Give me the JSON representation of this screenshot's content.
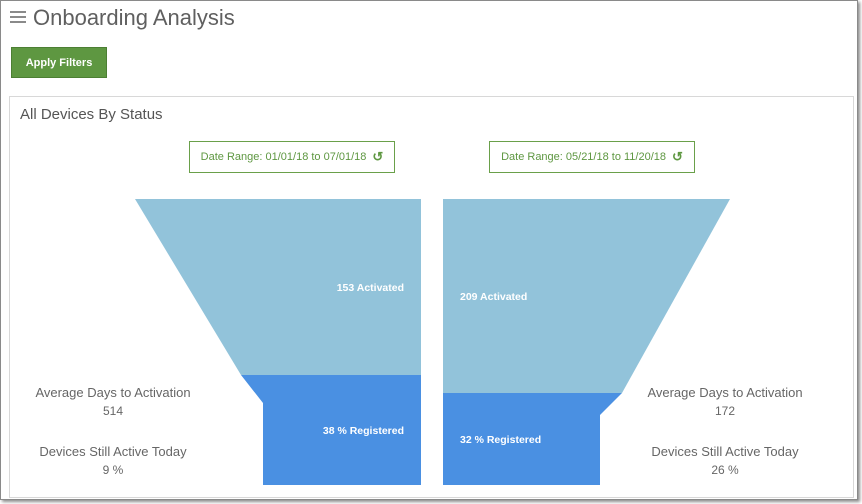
{
  "header": {
    "title": "Onboarding Analysis"
  },
  "toolbar": {
    "apply_filters_label": "Apply Filters"
  },
  "panel": {
    "title": "All Devices By Status",
    "left": {
      "date_range": "Date Range: 01/01/18 to 07/01/18",
      "activated": "153 Activated",
      "registered": "38 % Registered",
      "avg_days_label": "Average Days to Activation",
      "avg_days_value": "514",
      "still_active_label": "Devices Still Active Today",
      "still_active_value": "9 %"
    },
    "right": {
      "date_range": "Date Range: 05/21/18 to 11/20/18",
      "activated": "209 Activated",
      "registered": "32 % Registered",
      "avg_days_label": "Average Days to Activation",
      "avg_days_value": "172",
      "still_active_label": "Devices Still Active Today",
      "still_active_value": "26 %"
    }
  },
  "colors": {
    "activated": "#92c3da",
    "registered": "#4a90e2",
    "button": "#5e9741"
  },
  "icons": {
    "menu": "hamburger-icon",
    "refresh": "refresh-icon"
  }
}
